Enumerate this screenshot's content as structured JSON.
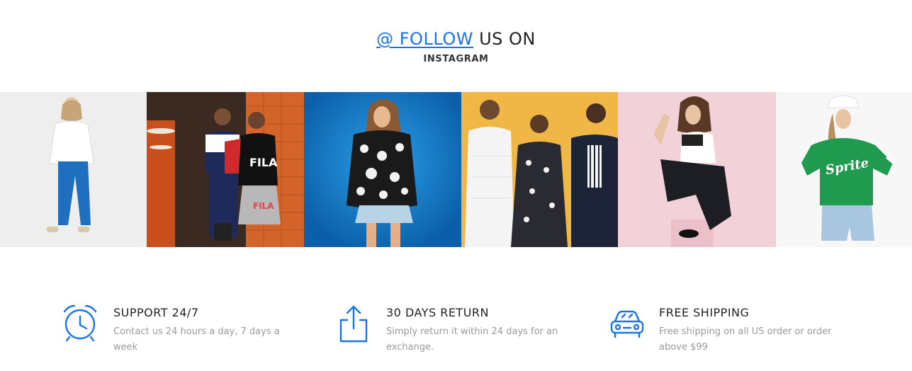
{
  "heading": {
    "link_text": "@ FOLLOW",
    "rest_text": " US ON",
    "subtitle": "INSTAGRAM"
  },
  "gallery": {
    "items": [
      {
        "alt": "instagram-photo-1"
      },
      {
        "alt": "instagram-photo-2",
        "shirt_text": "FILA",
        "skirt_text": "FILA"
      },
      {
        "alt": "instagram-photo-3"
      },
      {
        "alt": "instagram-photo-4"
      },
      {
        "alt": "instagram-photo-5"
      },
      {
        "alt": "instagram-photo-6",
        "shirt_text": "Sprite"
      }
    ]
  },
  "features": [
    {
      "icon": "alarm-clock-icon",
      "title": "SUPPORT 24/7",
      "desc": "Contact us 24 hours a day, 7 days a week"
    },
    {
      "icon": "share-upload-icon",
      "title": "30 DAYS RETURN",
      "desc": "Simply return it within 24 days for an exchange."
    },
    {
      "icon": "car-icon",
      "title": "FREE SHIPPING",
      "desc": "Free shipping on all US order or order above $99"
    }
  ],
  "colors": {
    "accent": "#1a73e8",
    "title_text": "#222222",
    "desc_text": "#9a9a9a"
  }
}
